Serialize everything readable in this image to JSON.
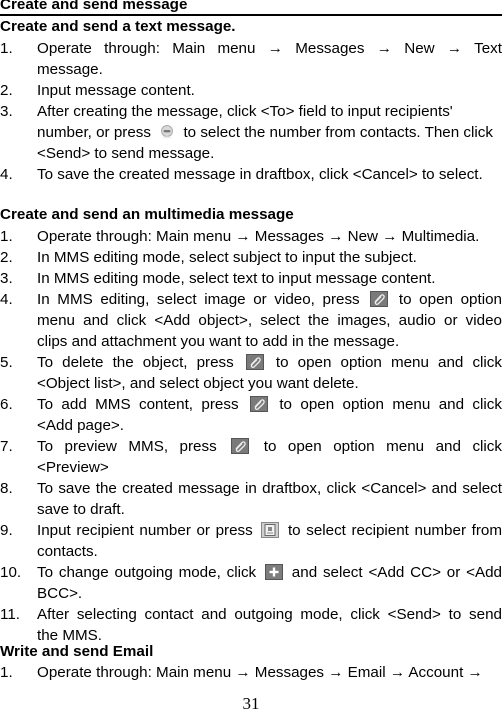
{
  "header": {
    "title": "Create and send message"
  },
  "sections": [
    {
      "title": "Create and send a text message.",
      "items": [
        {
          "num": "1.",
          "lines": [
            "Operate through: Main menu → Messages → New → Text",
            "message."
          ]
        },
        {
          "num": "2.",
          "lines": [
            "Input message content."
          ]
        },
        {
          "num": "3.",
          "lines": [
            "After creating the message, click <To> field to input recipients'",
            "number, or press",
            "to select the number from contacts. Then click",
            "<Send> to send message."
          ]
        },
        {
          "num": "4.",
          "lines": [
            "To save the created message in draftbox, click <Cancel> to select."
          ]
        }
      ]
    },
    {
      "title": "Create and send an multimedia message",
      "items": [
        {
          "num": "1.",
          "lines": [
            "Operate through: Main menu → Messages → New → Multimedia."
          ]
        },
        {
          "num": "2.",
          "lines": [
            "In MMS editing mode, select subject to input the subject."
          ]
        },
        {
          "num": "3.",
          "lines": [
            "In MMS editing mode, select text to input message content."
          ]
        },
        {
          "num": "4.",
          "lines": [
            "In MMS editing, select image or video, press",
            "to open option",
            "menu and click <Add object>, select the images, audio or video",
            "clips and attachment you want to add in the message."
          ]
        },
        {
          "num": "5.",
          "lines": [
            "To delete the object, press",
            "to open option menu and click",
            "<Object list>, and select object you want delete."
          ]
        },
        {
          "num": "6.",
          "lines": [
            "To add MMS content, press",
            "to open option menu and click",
            "<Add page>."
          ]
        },
        {
          "num": "7.",
          "lines": [
            "To preview MMS, press",
            "to open option menu and click",
            "<Preview>"
          ]
        },
        {
          "num": "8.",
          "lines": [
            "To save the created message in draftbox, click <Cancel> and select",
            "save to draft."
          ]
        },
        {
          "num": "9.",
          "lines": [
            "Input recipient number or press",
            "to select recipient number from",
            "contacts."
          ]
        },
        {
          "num": "10.",
          "lines": [
            "To change outgoing mode, click",
            "and select <Add CC> or <Add",
            "BCC>."
          ]
        },
        {
          "num": "11.",
          "lines": [
            "After selecting contact and outgoing mode, click <Send> to send",
            "the MMS."
          ]
        }
      ]
    },
    {
      "title": "Write and send Email",
      "items": [
        {
          "num": "1.",
          "lines": [
            "Operate through: Main menu → Messages → Email → Account →"
          ]
        }
      ]
    }
  ],
  "icons": {
    "contacts_round": "contacts-select-icon",
    "options": "option-menu-icon",
    "recipient": "recipient-contacts-icon",
    "add": "add-plus-icon"
  },
  "footer": {
    "page_number": "31"
  }
}
